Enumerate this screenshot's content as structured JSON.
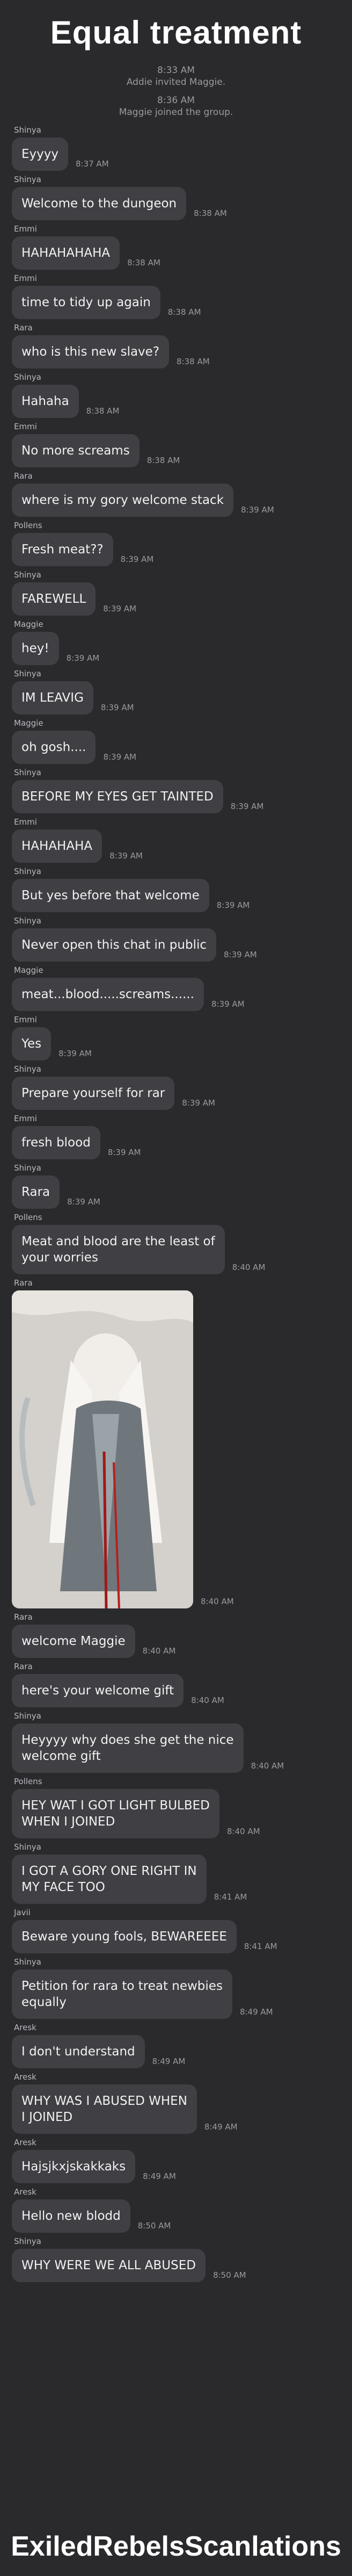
{
  "title": "Equal treatment",
  "system": [
    {
      "time": "8:33 AM",
      "text": "Addie invited Maggie."
    },
    {
      "time": "8:36 AM",
      "text": "Maggie joined the group."
    }
  ],
  "messages": [
    {
      "sender": "Shinya",
      "text": "Eyyyy",
      "time": "8:37 AM"
    },
    {
      "sender": "Shinya",
      "text": "Welcome to the dungeon",
      "time": "8:38 AM"
    },
    {
      "sender": "Emmi",
      "text": "HAHAHAHAHA",
      "time": "8:38 AM"
    },
    {
      "sender": "Emmi",
      "text": "time to tidy up again",
      "time": "8:38 AM"
    },
    {
      "sender": "Rara",
      "text": "who is this new slave?",
      "time": "8:38 AM"
    },
    {
      "sender": "Shinya",
      "text": "Hahaha",
      "time": "8:38 AM"
    },
    {
      "sender": "Emmi",
      "text": "No more screams",
      "time": "8:38 AM"
    },
    {
      "sender": "Rara",
      "text": "where is my gory welcome stack",
      "time": "8:39 AM"
    },
    {
      "sender": "Pollens",
      "text": "Fresh meat??",
      "time": "8:39 AM"
    },
    {
      "sender": "Shinya",
      "text": "FAREWELL",
      "time": "8:39 AM"
    },
    {
      "sender": "Maggie",
      "text": "hey!",
      "time": "8:39 AM"
    },
    {
      "sender": "Shinya",
      "text": "IM LEAVIG",
      "time": "8:39 AM"
    },
    {
      "sender": "Maggie",
      "text": "oh gosh....",
      "time": "8:39 AM"
    },
    {
      "sender": "Shinya",
      "text": "BEFORE MY EYES GET TAINTED",
      "time": "8:39 AM"
    },
    {
      "sender": "Emmi",
      "text": "HAHAHAHA",
      "time": "8:39 AM"
    },
    {
      "sender": "Shinya",
      "text": "But yes before that welcome",
      "time": "8:39 AM"
    },
    {
      "sender": "Shinya",
      "text": "Never open this chat in public",
      "time": "8:39 AM"
    },
    {
      "sender": "Maggie",
      "text": "meat...blood.....screams......",
      "time": "8:39 AM"
    },
    {
      "sender": "Emmi",
      "text": "Yes",
      "time": "8:39 AM"
    },
    {
      "sender": "Shinya",
      "text": "Prepare yourself for rar",
      "time": "8:39 AM"
    },
    {
      "sender": "Emmi",
      "text": "fresh blood",
      "time": "8:39 AM"
    },
    {
      "sender": "Shinya",
      "text": "Rara",
      "time": "8:39 AM"
    },
    {
      "sender": "Pollens",
      "text": "Meat and blood are the least of\nyour worries",
      "time": "8:40 AM"
    },
    {
      "sender": "Rara",
      "image": true,
      "time": "8:40 AM"
    },
    {
      "sender": "Rara",
      "text": "welcome Maggie",
      "time": "8:40 AM"
    },
    {
      "sender": "Rara",
      "text": "here's your welcome gift",
      "time": "8:40 AM"
    },
    {
      "sender": "Shinya",
      "text": "Heyyyy why does she get the nice\nwelcome gift",
      "time": "8:40 AM"
    },
    {
      "sender": "Pollens",
      "text": "HEY WAT I GOT LIGHT BULBED\nWHEN I JOINED",
      "time": "8:40 AM"
    },
    {
      "sender": "Shinya",
      "text": "I GOT A GORY ONE RIGHT IN\nMY FACE TOO",
      "time": "8:41 AM"
    },
    {
      "sender": "Javii",
      "text": "Beware young fools, BEWAREEEE",
      "time": "8:41 AM"
    },
    {
      "sender": "Shinya",
      "text": "Petition for rara to treat newbies\nequally",
      "time": "8:49 AM"
    },
    {
      "sender": "Aresk",
      "text": "I don't understand",
      "time": "8:49 AM"
    },
    {
      "sender": "Aresk",
      "text": "WHY WAS I ABUSED WHEN\nI JOINED",
      "time": "8:49 AM"
    },
    {
      "sender": "Aresk",
      "text": "Hajsjkxjskakkaks",
      "time": "8:49 AM"
    },
    {
      "sender": "Aresk",
      "text": "Hello new blodd",
      "time": "8:50 AM"
    },
    {
      "sender": "Shinya",
      "text": "WHY WERE WE ALL ABUSED",
      "time": "8:50 AM"
    }
  ],
  "icons": {
    "share": "share-icon"
  },
  "footer": "ExiledRebelsScanlations",
  "colors": {
    "background": "#2a2a2d",
    "bubble": "#3f3f44",
    "muted": "#9a9aa0"
  }
}
